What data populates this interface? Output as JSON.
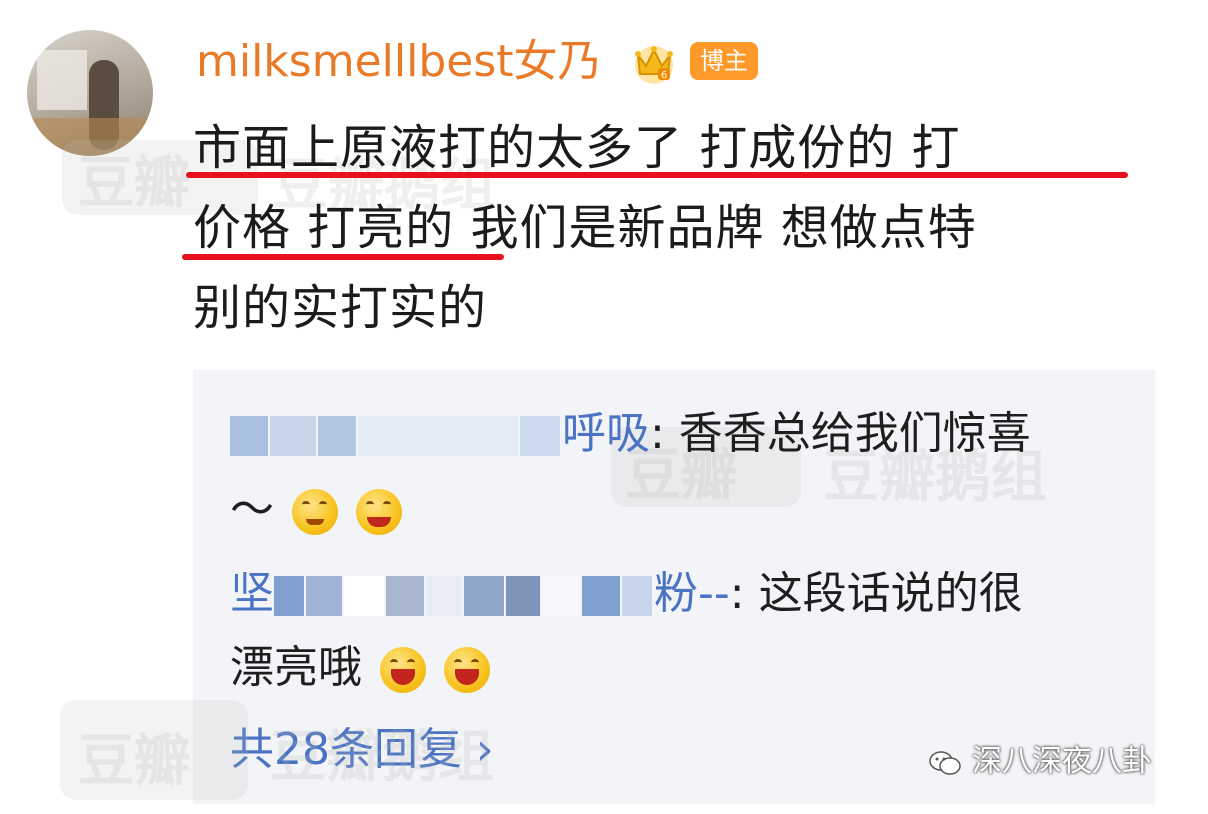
{
  "post": {
    "username": "milksmelllbest女乃",
    "badge": "博主",
    "text_line1": "市面上原液打的太多了 打成份的 打",
    "text_line2": "价格 打亮的 我们是新品牌  想做点特",
    "text_line3": "别的实打实的"
  },
  "replies": [
    {
      "name_visible": "呼吸",
      "text_line1": ": 香香总给我们惊喜",
      "text_line2": "～"
    },
    {
      "name_prefix": "坚",
      "name_suffix": "粉--",
      "text_line1": ": 这段话说的很",
      "text_line2": "漂亮哦"
    }
  ],
  "more_replies": "共28条回复 ›",
  "watermarks": {
    "douban": "豆瓣",
    "douban_group": "豆瓣鹅组",
    "footer": "深八深夜八卦"
  },
  "colors": {
    "username": "#ea7a28",
    "badge_bg": "#ff9a2a",
    "underline": "#e8101a",
    "link": "#4a73c4",
    "reply_bg": "#f3f4f7"
  },
  "icons": [
    "crown-icon",
    "wechat-icon",
    "laugh-emoji",
    "cover-mouth-emoji"
  ]
}
